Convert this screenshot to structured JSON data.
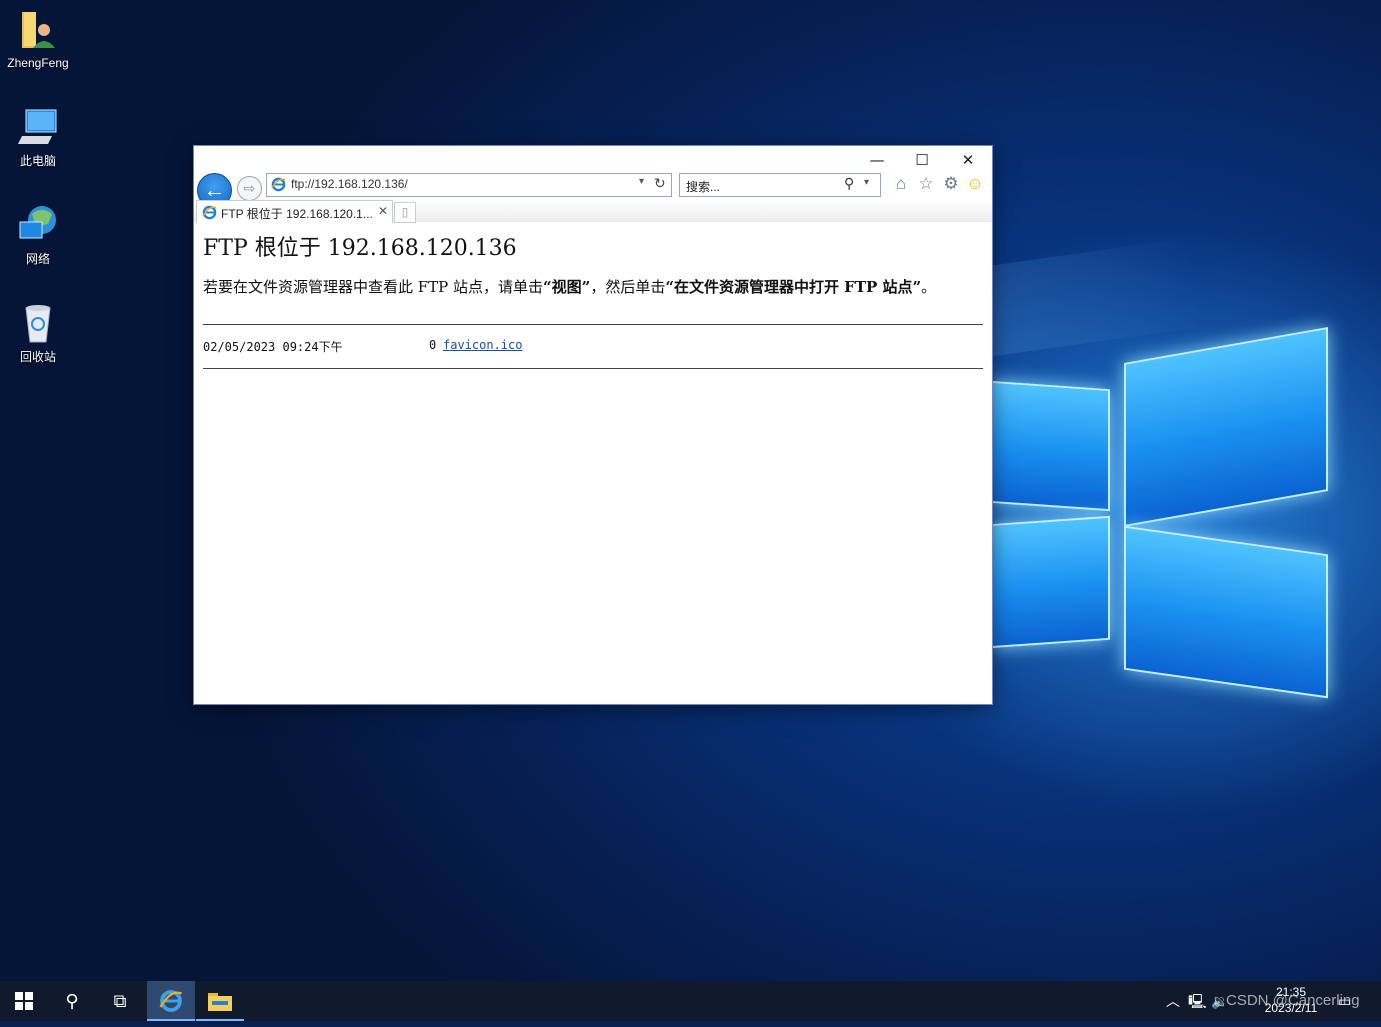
{
  "desktop": {
    "icons": [
      {
        "label": "ZhengFeng",
        "icon": "user-folder-icon"
      },
      {
        "label": "此电脑",
        "icon": "computer-icon"
      },
      {
        "label": "网络",
        "icon": "network-icon"
      },
      {
        "label": "回收站",
        "icon": "recycle-bin-icon"
      }
    ]
  },
  "browser": {
    "address": "ftp://192.168.120.136/",
    "search_placeholder": "搜索...",
    "tab_title": "FTP 根位于 192.168.120.1...",
    "caption": {
      "minimize": "—",
      "maximize": "☐",
      "close": "✕"
    }
  },
  "page": {
    "heading": "FTP 根位于 192.168.120.136",
    "desc_prefix": "若要在文件资源管理器中查看此 FTP 站点，请单击",
    "desc_view": "“视图”",
    "desc_mid": "，然后单击",
    "desc_open": "“在文件资源管理器中打开 FTP 站点”",
    "desc_end": "。",
    "listing": [
      {
        "date": "02/05/2023 09:24下午",
        "size": "0",
        "name": "favicon.ico"
      }
    ]
  },
  "taskbar": {
    "time": "21:35",
    "date": "2023/2/11"
  },
  "watermark": "CSDN @Cancerling"
}
